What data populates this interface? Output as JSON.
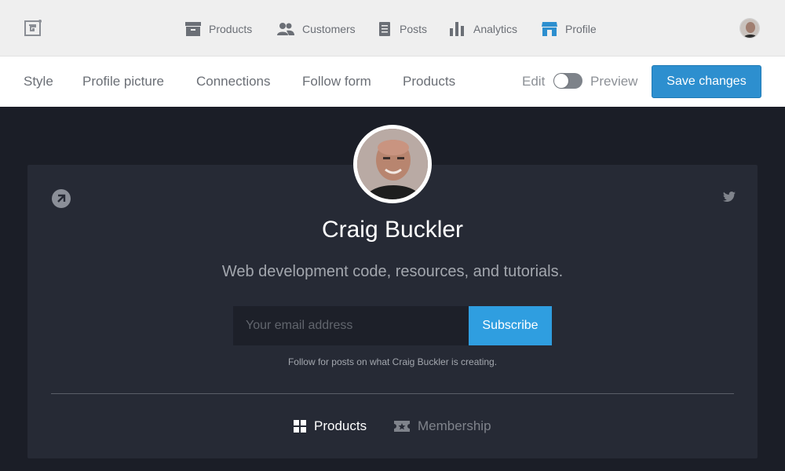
{
  "topnav": {
    "items": [
      {
        "label": "Products",
        "icon": "store-box-icon"
      },
      {
        "label": "Customers",
        "icon": "users-icon"
      },
      {
        "label": "Posts",
        "icon": "document-icon"
      },
      {
        "label": "Analytics",
        "icon": "bar-chart-icon"
      },
      {
        "label": "Profile",
        "icon": "storefront-icon"
      }
    ]
  },
  "editor": {
    "tabs": [
      {
        "label": "Style"
      },
      {
        "label": "Profile picture"
      },
      {
        "label": "Connections"
      },
      {
        "label": "Follow form"
      },
      {
        "label": "Products"
      }
    ],
    "mode_edit": "Edit",
    "mode_preview": "Preview",
    "save_label": "Save changes"
  },
  "profile": {
    "name": "Craig Buckler",
    "tagline": "Web development code, resources, and tutorials.",
    "email_placeholder": "Your email address",
    "subscribe_label": "Subscribe",
    "follow_note": "Follow for posts on what Craig Buckler is creating.",
    "bottom_tabs": [
      {
        "label": "Products"
      },
      {
        "label": "Membership"
      }
    ]
  },
  "colors": {
    "accent": "#2d8fcf",
    "subscribe": "#2f9ee0",
    "dark_bg": "#1b1e27",
    "card_bg": "#262a35"
  }
}
